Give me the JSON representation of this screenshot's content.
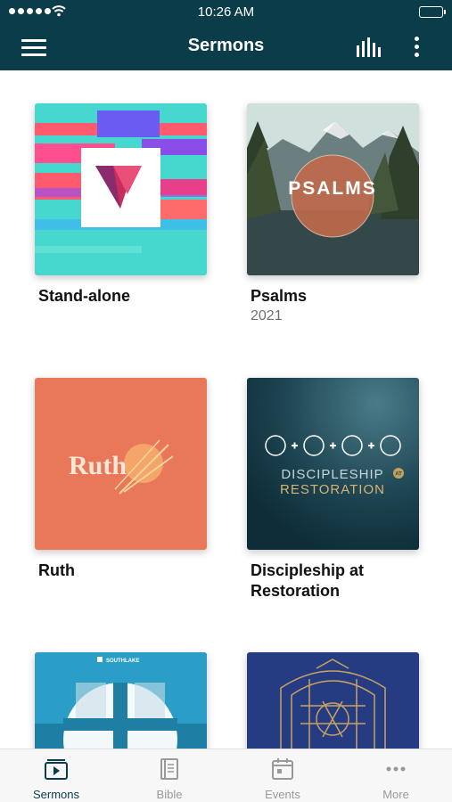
{
  "status_bar": {
    "time": "10:26 AM"
  },
  "header": {
    "title": "Sermons"
  },
  "series": [
    {
      "name": "Stand-alone",
      "year": ""
    },
    {
      "name": "Psalms",
      "year": "2021",
      "art_text": "PSALMS"
    },
    {
      "name": "Ruth",
      "year": "",
      "art_text": "Ruth"
    },
    {
      "name": "Discipleship at Restoration",
      "year": "",
      "art_text_top": "DISCIPLESHIP",
      "art_text_bottom": "RESTORATION",
      "art_text_mark": "AT"
    },
    {
      "name": "",
      "year": "",
      "art_text": "SOUTHLAKE"
    },
    {
      "name": "",
      "year": ""
    }
  ],
  "tabs": [
    {
      "label": "Sermons",
      "icon": "sermons-icon",
      "active": true
    },
    {
      "label": "Bible",
      "icon": "bible-icon",
      "active": false
    },
    {
      "label": "Events",
      "icon": "events-icon",
      "active": false
    },
    {
      "label": "More",
      "icon": "more-icon",
      "active": false
    }
  ],
  "colors": {
    "brand": "#0b3c49",
    "tab_active": "#0b3c49",
    "tab_inactive": "#999999"
  }
}
